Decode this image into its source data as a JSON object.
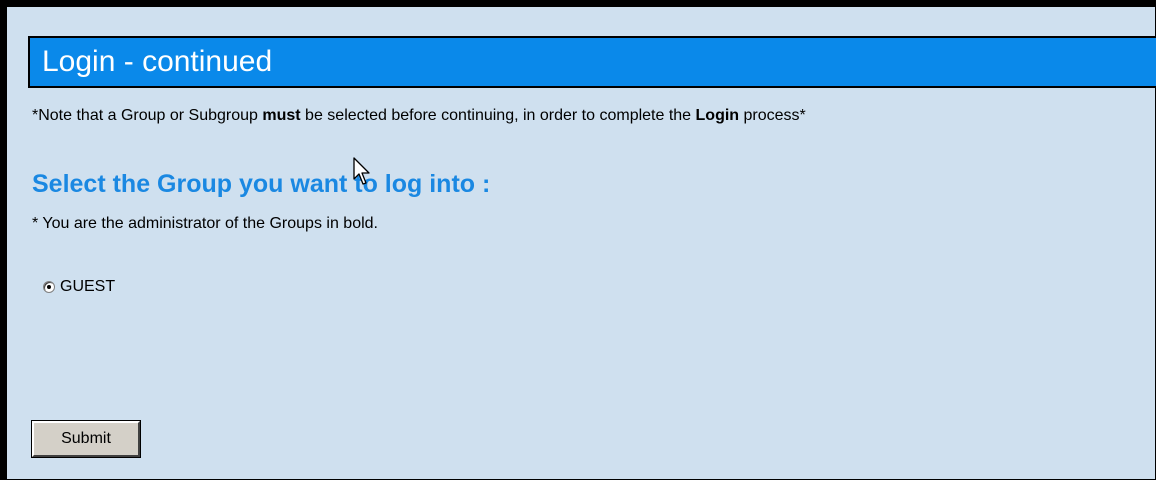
{
  "header": {
    "title": "Login - continued"
  },
  "note": {
    "prefix": "*Note that a Group or Subgroup ",
    "must": "must",
    "middle": " be selected before continuing, in order to complete the ",
    "login": "Login",
    "suffix": " process*"
  },
  "main": {
    "heading": "Select the Group you want to log into :",
    "admin_note": "* You are the administrator of the Groups in bold.",
    "groups": [
      {
        "label": "GUEST",
        "selected": true
      }
    ],
    "submit_label": "Submit"
  },
  "colors": {
    "title_bar": "#0a89ea",
    "heading": "#1a88e2",
    "background": "#cfe0ef"
  }
}
